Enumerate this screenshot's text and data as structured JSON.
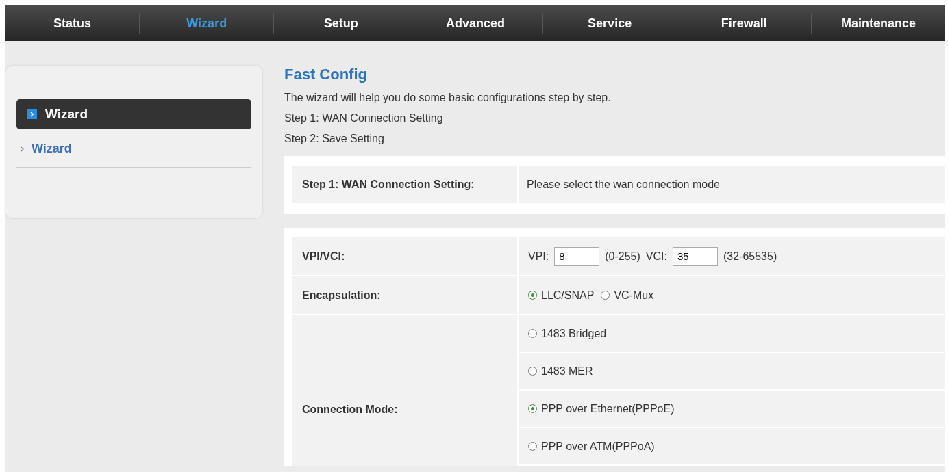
{
  "nav": [
    {
      "label": "Status",
      "selected": false
    },
    {
      "label": "Wizard",
      "selected": true
    },
    {
      "label": "Setup",
      "selected": false
    },
    {
      "label": "Advanced",
      "selected": false
    },
    {
      "label": "Service",
      "selected": false
    },
    {
      "label": "Firewall",
      "selected": false
    },
    {
      "label": "Maintenance",
      "selected": false
    }
  ],
  "sidebar": {
    "header": "Wizard",
    "items": [
      {
        "label": "Wizard"
      }
    ]
  },
  "content": {
    "title": "Fast Config",
    "intro": [
      "The wizard will help you do some basic configurations step by step.",
      "Step 1: WAN Connection Setting",
      "Step 2: Save Setting"
    ]
  },
  "step": {
    "label": "Step 1: WAN Connection Setting:",
    "note": "Please select the wan connection mode"
  },
  "vpi_vci": {
    "label": "VPI/VCI:",
    "vpi_label": "VPI:",
    "vpi": "8",
    "vpi_range": "(0-255)",
    "vci_label": "VCI:",
    "vci": "35",
    "vci_range": "(32-65535)"
  },
  "encapsulation": {
    "label": "Encapsulation:",
    "options": [
      {
        "label": "LLC/SNAP",
        "selected": true
      },
      {
        "label": "VC-Mux",
        "selected": false
      }
    ]
  },
  "connection_mode": {
    "label": "Connection Mode:",
    "options": [
      {
        "label": "1483 Bridged",
        "selected": false
      },
      {
        "label": "1483 MER",
        "selected": false
      },
      {
        "label": "PPP over Ethernet(PPPoE)",
        "selected": true
      },
      {
        "label": "PPP over ATM(PPPoA)",
        "selected": false
      }
    ]
  }
}
